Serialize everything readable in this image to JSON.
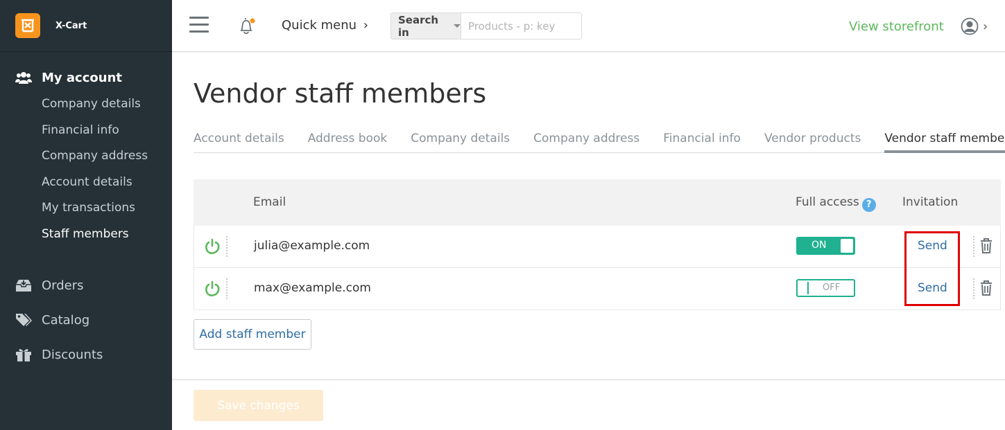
{
  "brand": {
    "name": "X-Cart",
    "logo_icon": "x-cart-logo-icon",
    "logo_color": "#f7941d"
  },
  "sidebar": {
    "account_title": "My account",
    "account_items": [
      {
        "label": "Company details",
        "active": false
      },
      {
        "label": "Financial info",
        "active": false
      },
      {
        "label": "Company address",
        "active": false
      },
      {
        "label": "Account details",
        "active": false
      },
      {
        "label": "My transactions",
        "active": false
      },
      {
        "label": "Staff members",
        "active": true
      }
    ],
    "items": [
      {
        "label": "Orders",
        "icon": "inbox-icon"
      },
      {
        "label": "Catalog",
        "icon": "tags-icon"
      },
      {
        "label": "Discounts",
        "icon": "gift-icon"
      }
    ]
  },
  "header": {
    "quick_menu": "Quick menu",
    "search_scope": "Search in",
    "search_placeholder": "Products - p: key",
    "view_storefront": "View storefront"
  },
  "page": {
    "title": "Vendor staff members",
    "tabs": [
      {
        "label": "Account details",
        "active": false
      },
      {
        "label": "Address book",
        "active": false
      },
      {
        "label": "Company details",
        "active": false
      },
      {
        "label": "Company address",
        "active": false
      },
      {
        "label": "Financial info",
        "active": false
      },
      {
        "label": "Vendor products",
        "active": false
      },
      {
        "label": "Vendor staff members",
        "active": true
      }
    ]
  },
  "table": {
    "columns": {
      "email": "Email",
      "full_access": "Full access",
      "invitation": "Invitation"
    },
    "help_icon": "?",
    "rows": [
      {
        "email": "julia@example.com",
        "full_access": "ON",
        "invitation": "Send"
      },
      {
        "email": "max@example.com",
        "full_access": "OFF",
        "invitation": "Send"
      }
    ]
  },
  "actions": {
    "add_staff": "Add staff member",
    "save": "Save changes"
  },
  "colors": {
    "accent_green": "#5cb85c",
    "toggle_green": "#1fb190",
    "link_blue": "#2e6da4",
    "highlight_red": "#e00000",
    "sidebar_bg": "#253137"
  }
}
